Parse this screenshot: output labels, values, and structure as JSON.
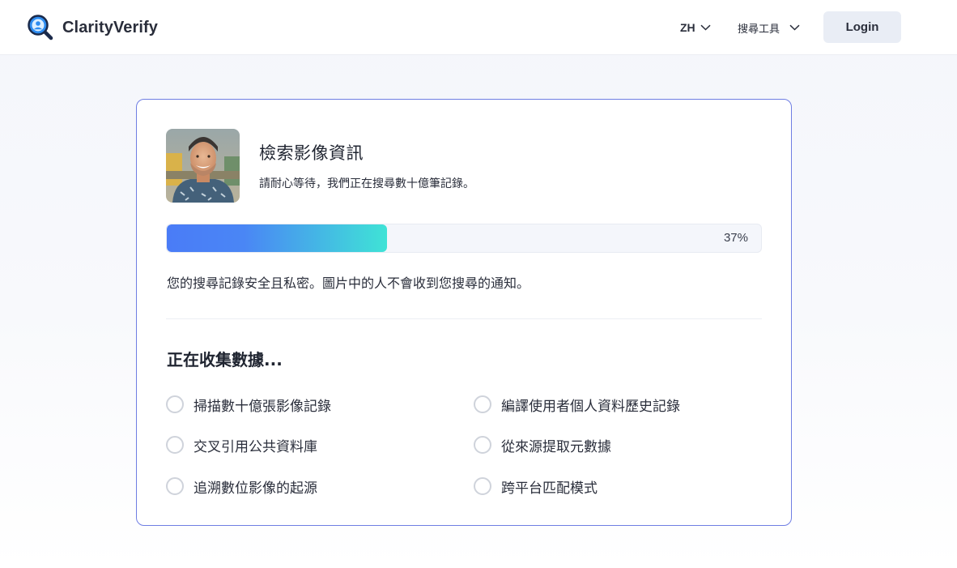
{
  "header": {
    "brand_name": "ClarityVerify",
    "language_label": "ZH",
    "tools_label": "搜尋工具",
    "login_label": "Login"
  },
  "colors": {
    "brand_blue": "#2d8cf0",
    "card_border": "#6f7ee3",
    "progress_start": "#4a7cf7",
    "progress_end": "#3fe3d6",
    "login_bg": "#e9edf5"
  },
  "card": {
    "title": "檢索影像資訊",
    "subtitle": "請耐心等待，我們正在搜尋數十億筆記錄。",
    "progress": {
      "percent": 37,
      "label": "37%"
    },
    "privacy_note": "您的搜尋記錄安全且私密。圖片中的人不會收到您搜尋的通知。",
    "section_title": "正在收集數據...",
    "tasks": [
      {
        "label": "掃描數十億張影像記錄",
        "done": false
      },
      {
        "label": "編譯使用者個人資料歷史記錄",
        "done": false
      },
      {
        "label": "交叉引用公共資料庫",
        "done": false
      },
      {
        "label": "從來源提取元數據",
        "done": false
      },
      {
        "label": "追溯數位影像的起源",
        "done": false
      },
      {
        "label": "跨平台匹配模式",
        "done": false
      }
    ]
  },
  "icons": {
    "brand": "magnifier-logo-icon",
    "dropdown": "chevron-down-icon",
    "task_status": "empty-circle-icon"
  }
}
